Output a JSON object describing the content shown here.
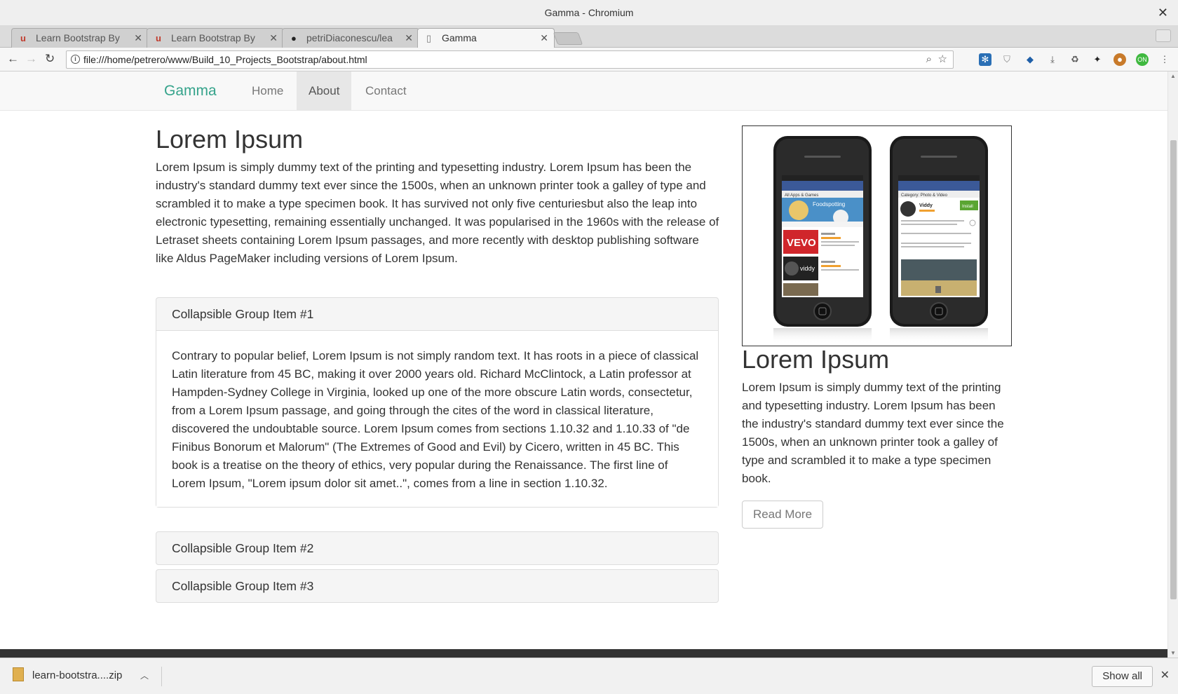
{
  "window": {
    "title": "Gamma - Chromium"
  },
  "tabs": [
    {
      "label": "Learn Bootstrap By",
      "icon": "udemy-icon"
    },
    {
      "label": "Learn Bootstrap By",
      "icon": "udemy-icon"
    },
    {
      "label": "petriDiaconescu/lea",
      "icon": "github-icon"
    },
    {
      "label": "Gamma",
      "icon": "document-icon",
      "active": true
    }
  ],
  "address_bar": {
    "url": "file:///home/petrero/www/Build_10_Projects_Bootstrap/about.html"
  },
  "navbar": {
    "brand": "Gamma",
    "links": [
      {
        "label": "Home"
      },
      {
        "label": "About",
        "active": true
      },
      {
        "label": "Contact"
      }
    ]
  },
  "main": {
    "heading": "Lorem Ipsum",
    "paragraph": "Lorem Ipsum is simply dummy text of the printing and typesetting industry. Lorem Ipsum has been the industry's standard dummy text ever since the 1500s, when an unknown printer took a galley of type and scrambled it to make a type specimen book. It has survived not only five centuriesbut also the leap into electronic typesetting, remaining essentially unchanged. It was popularised in the 1960s with the release of Letraset sheets containing Lorem Ipsum passages, and more recently with desktop publishing software like Aldus PageMaker including versions of Lorem Ipsum."
  },
  "accordion": [
    {
      "title": "Collapsible Group Item #1",
      "expanded": true,
      "body": "Contrary to popular belief, Lorem Ipsum is not simply random text. It has roots in a piece of classical Latin literature from 45 BC, making it over 2000 years old. Richard McClintock, a Latin professor at Hampden-Sydney College in Virginia, looked up one of the more obscure Latin words, consectetur, from a Lorem Ipsum passage, and going through the cites of the word in classical literature, discovered the undoubtable source. Lorem Ipsum comes from sections 1.10.32 and 1.10.33 of \"de Finibus Bonorum et Malorum\" (The Extremes of Good and Evil) by Cicero, written in 45 BC. This book is a treatise on the theory of ethics, very popular during the Renaissance. The first line of Lorem Ipsum, \"Lorem ipsum dolor sit amet..\", comes from a line in section 1.10.32."
    },
    {
      "title": "Collapsible Group Item #2",
      "expanded": false
    },
    {
      "title": "Collapsible Group Item #3",
      "expanded": false
    }
  ],
  "sidebar": {
    "image_alt_content": "two smartphones showing app store screens",
    "phone_left": {
      "header": "All Apps & Games",
      "banner": "Foodspotting",
      "brand": "VEVO",
      "app2": "viddy"
    },
    "phone_right": {
      "header": "Category: Photo & Video",
      "app": "Viddy",
      "install": "Install"
    },
    "heading": "Lorem Ipsum",
    "paragraph": "Lorem Ipsum is simply dummy text of the printing and typesetting industry. Lorem Ipsum has been the industry's standard dummy text ever since the 1500s, when an unknown printer took a galley of type and scrambled it to make a type specimen book.",
    "button_label": "Read More"
  },
  "downloads": {
    "file": "learn-bootstra....zip",
    "show_all": "Show all"
  },
  "colors": {
    "brand": "#35a38b",
    "navbar_bg": "#f8f8f8",
    "footer": "#333333",
    "vevo_red": "#d0262b"
  }
}
